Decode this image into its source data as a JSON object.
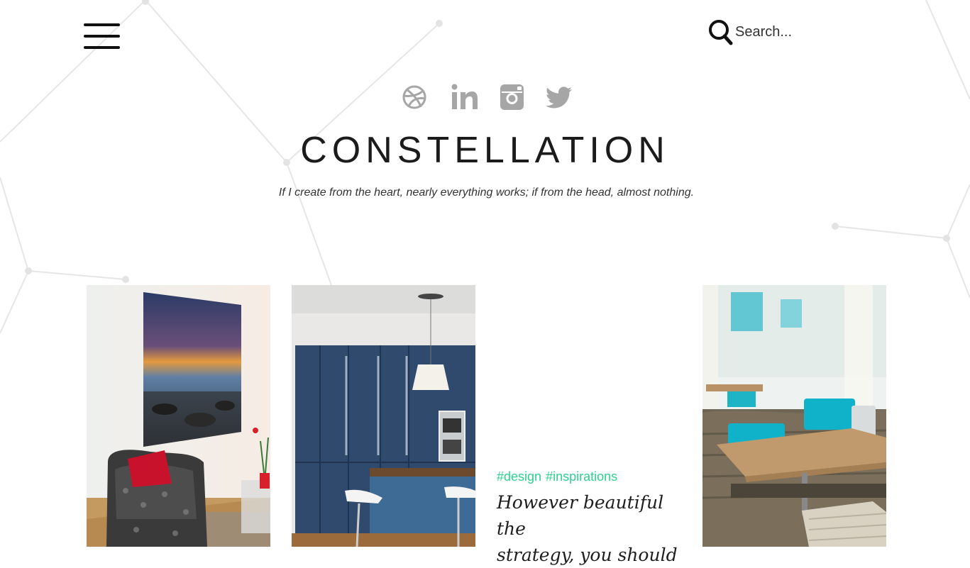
{
  "header": {
    "menu_icon": "hamburger-menu-icon",
    "search_icon": "search-icon",
    "search_placeholder": "Search..."
  },
  "social": [
    {
      "name": "dribbble",
      "icon": "dribbble-icon"
    },
    {
      "name": "linkedin",
      "icon": "linkedin-icon"
    },
    {
      "name": "instagram",
      "icon": "instagram-icon"
    },
    {
      "name": "twitter",
      "icon": "twitter-icon"
    }
  ],
  "site": {
    "title": "CONSTELLATION",
    "tagline": "If I create from the heart, nearly everything works; if from the head, almost nothing."
  },
  "posts": [
    {
      "type": "image"
    },
    {
      "type": "image"
    },
    {
      "type": "text",
      "tags": [
        "#design",
        "#inspirations"
      ],
      "title_lines": [
        "However beautiful the",
        "strategy, you should"
      ]
    },
    {
      "type": "image"
    }
  ],
  "colors": {
    "accent": "#2ed18f",
    "icon_gray": "#a6a6a6",
    "text": "#1b1b1b",
    "background_lines": "#e8e8e8"
  }
}
